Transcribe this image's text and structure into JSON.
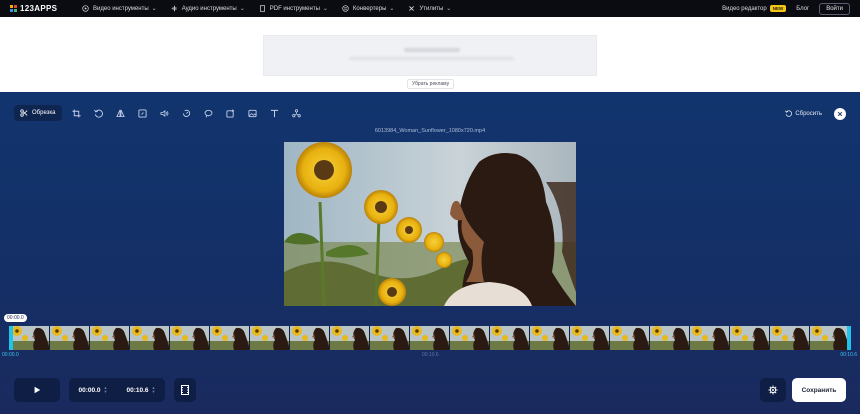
{
  "brand": {
    "logo_text": "123APPS",
    "logo_colors": [
      "#f0b400",
      "#e8453c",
      "#3c8ff0",
      "#3bbf6e"
    ]
  },
  "nav": {
    "items": [
      {
        "label": "Видео инструменты",
        "icon": "video-icon"
      },
      {
        "label": "Аудио инструменты",
        "icon": "audio-wave-icon"
      },
      {
        "label": "PDF инструменты",
        "icon": "pdf-icon"
      },
      {
        "label": "Конвертеры",
        "icon": "convert-icon"
      },
      {
        "label": "Утилиты",
        "icon": "tools-icon"
      }
    ],
    "editor_label": "Видео редактор",
    "editor_badge": "NEW",
    "blog_label": "Блог",
    "login_label": "Войти"
  },
  "ad": {
    "remove_label": "Убрать рекламу"
  },
  "toolbar": {
    "active_label": "Обрезка",
    "tools": [
      "crop-icon",
      "rotate-icon",
      "flip-icon",
      "resize-icon",
      "volume-icon",
      "speed-icon",
      "loop-icon",
      "image-add-icon",
      "photo-icon",
      "text-icon",
      "stabilize-icon"
    ],
    "reset_label": "Сбросить"
  },
  "video": {
    "filename": "6013984_Woman_Sunflower_1080x720.mp4"
  },
  "timeline": {
    "current_time": "00:00.0",
    "start_label": "00:00.0",
    "mid_label": "00:10.6",
    "end_label": "00:10.6",
    "frame_count": 21
  },
  "controls": {
    "start_time": "00:00.0",
    "end_time": "00:10.6",
    "save_label": "Сохранить"
  },
  "colors": {
    "accent": "#1fc4e8",
    "editor_bg": "#11346e",
    "topbar_bg": "#0b0c12",
    "badge": "#f5c518"
  }
}
